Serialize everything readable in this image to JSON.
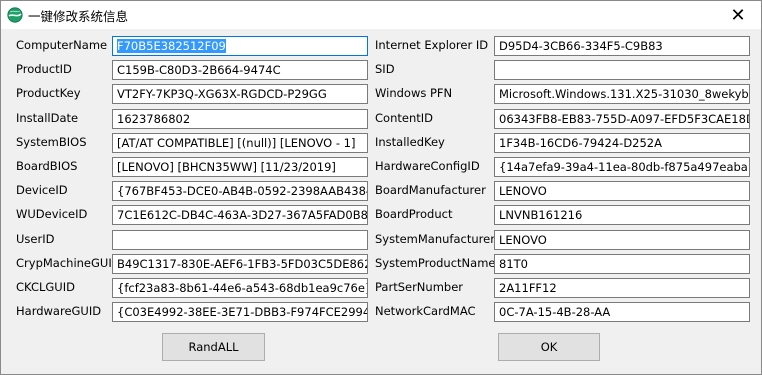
{
  "window": {
    "title": "一键修改系统信息",
    "close_glyph": "✕",
    "app_icon": "globe-icon"
  },
  "left": [
    {
      "label": "ComputerName",
      "value": "F70B5E382512F09",
      "selected": true
    },
    {
      "label": "ProductID",
      "value": "C159B-C80D3-2B664-9474C"
    },
    {
      "label": "ProductKey",
      "value": "VT2FY-7KP3Q-XG63X-RGDCD-P29GG"
    },
    {
      "label": "InstallDate",
      "value": "1623786802"
    },
    {
      "label": "SystemBIOS",
      "value": "[AT/AT COMPATIBLE] [(null)] [LENOVO - 1]"
    },
    {
      "label": "BoardBIOS",
      "value": "[LENOVO] [BHCN35WW] [11/23/2019]"
    },
    {
      "label": "DeviceID",
      "value": "{767BF453-DCE0-AB4B-0592-2398AAB4384B"
    },
    {
      "label": "WUDeviceID",
      "value": "7C1E612C-DB4C-463A-3D27-367A5FAD0B8E"
    },
    {
      "label": "UserID",
      "value": ""
    },
    {
      "label": "CrypMachineGUID",
      "value": "B49C1317-830E-AEF6-1FB3-5FD03C5DE862"
    },
    {
      "label": "CKCLGUID",
      "value": "{fcf23a83-8b61-44e6-a543-68db1ea9c76e}"
    },
    {
      "label": "HardwareGUID",
      "value": "{C03E4992-38EE-3E71-DBB3-F974FCE29940}"
    }
  ],
  "right": [
    {
      "label": "Internet Explorer ID",
      "value": "D95D4-3CB66-334F5-C9B83"
    },
    {
      "label": "SID",
      "value": ""
    },
    {
      "label": "Windows PFN",
      "value": "Microsoft.Windows.131.X25-31030_8wekyb3"
    },
    {
      "label": "ContentID",
      "value": "06343FB8-EB83-755D-A097-EFD5F3CAE18D"
    },
    {
      "label": "InstalledKey",
      "value": "1F34B-16CD6-79424-D252A"
    },
    {
      "label": "HardwareConfigID",
      "value": "{14a7efa9-39a4-11ea-80db-f875a497eaba}"
    },
    {
      "label": "BoardManufacturer",
      "value": "LENOVO"
    },
    {
      "label": "BoardProduct",
      "value": "LNVNB161216"
    },
    {
      "label": "SystemManufacturer",
      "value": "LENOVO"
    },
    {
      "label": "SystemProductName",
      "value": "81T0"
    },
    {
      "label": "PartSerNumber",
      "value": "2A11FF12"
    },
    {
      "label": "NetworkCardMAC",
      "value": "0C-7A-15-4B-28-AA"
    }
  ],
  "buttons": {
    "randall": "RandALL",
    "ok": "OK"
  }
}
